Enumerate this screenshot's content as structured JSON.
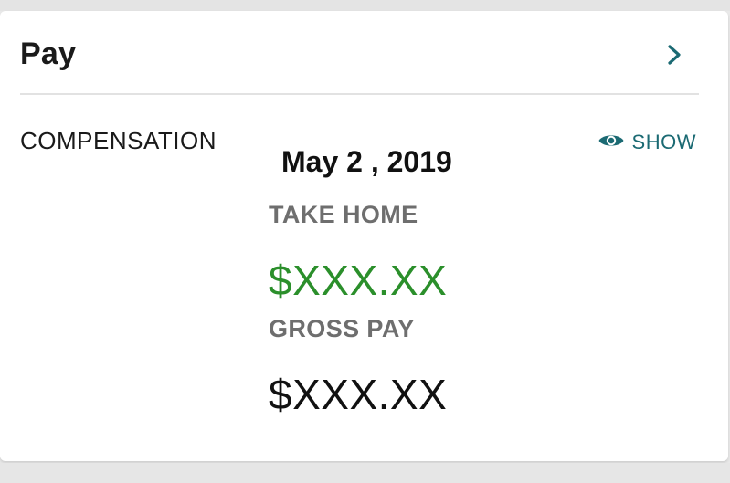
{
  "card": {
    "title": "Pay"
  },
  "compensation": {
    "section_label": "COMPENSATION",
    "show_label": "SHOW",
    "pay_date": "May 2 , 2019",
    "take_home_label": "TAKE HOME",
    "take_home_amount": "$XXX.XX",
    "gross_pay_label": "GROSS PAY",
    "gross_pay_amount": "$XXX.XX"
  },
  "icons": {
    "chevron": "chevron-right-icon",
    "eye": "eye-icon"
  },
  "colors": {
    "accent": "#1b6a73",
    "take_home": "#2b8f2b",
    "label_gray": "#6e6e6e"
  }
}
